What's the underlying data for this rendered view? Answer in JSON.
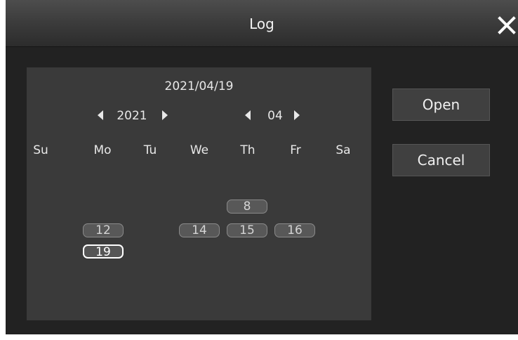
{
  "window": {
    "title": "Log"
  },
  "calendar": {
    "selected_date": "2021/04/19",
    "year": "2021",
    "month": "04",
    "weekdays": [
      "Su",
      "Mo",
      "Tu",
      "We",
      "Th",
      "Fr",
      "Sa"
    ],
    "days": [
      "8",
      "12",
      "14",
      "15",
      "16",
      "19"
    ],
    "selected_day": "19"
  },
  "buttons": {
    "open": "Open",
    "cancel": "Cancel"
  },
  "icons": {
    "close": "close-icon",
    "prev": "triangle-left-icon",
    "next": "triangle-right-icon"
  }
}
